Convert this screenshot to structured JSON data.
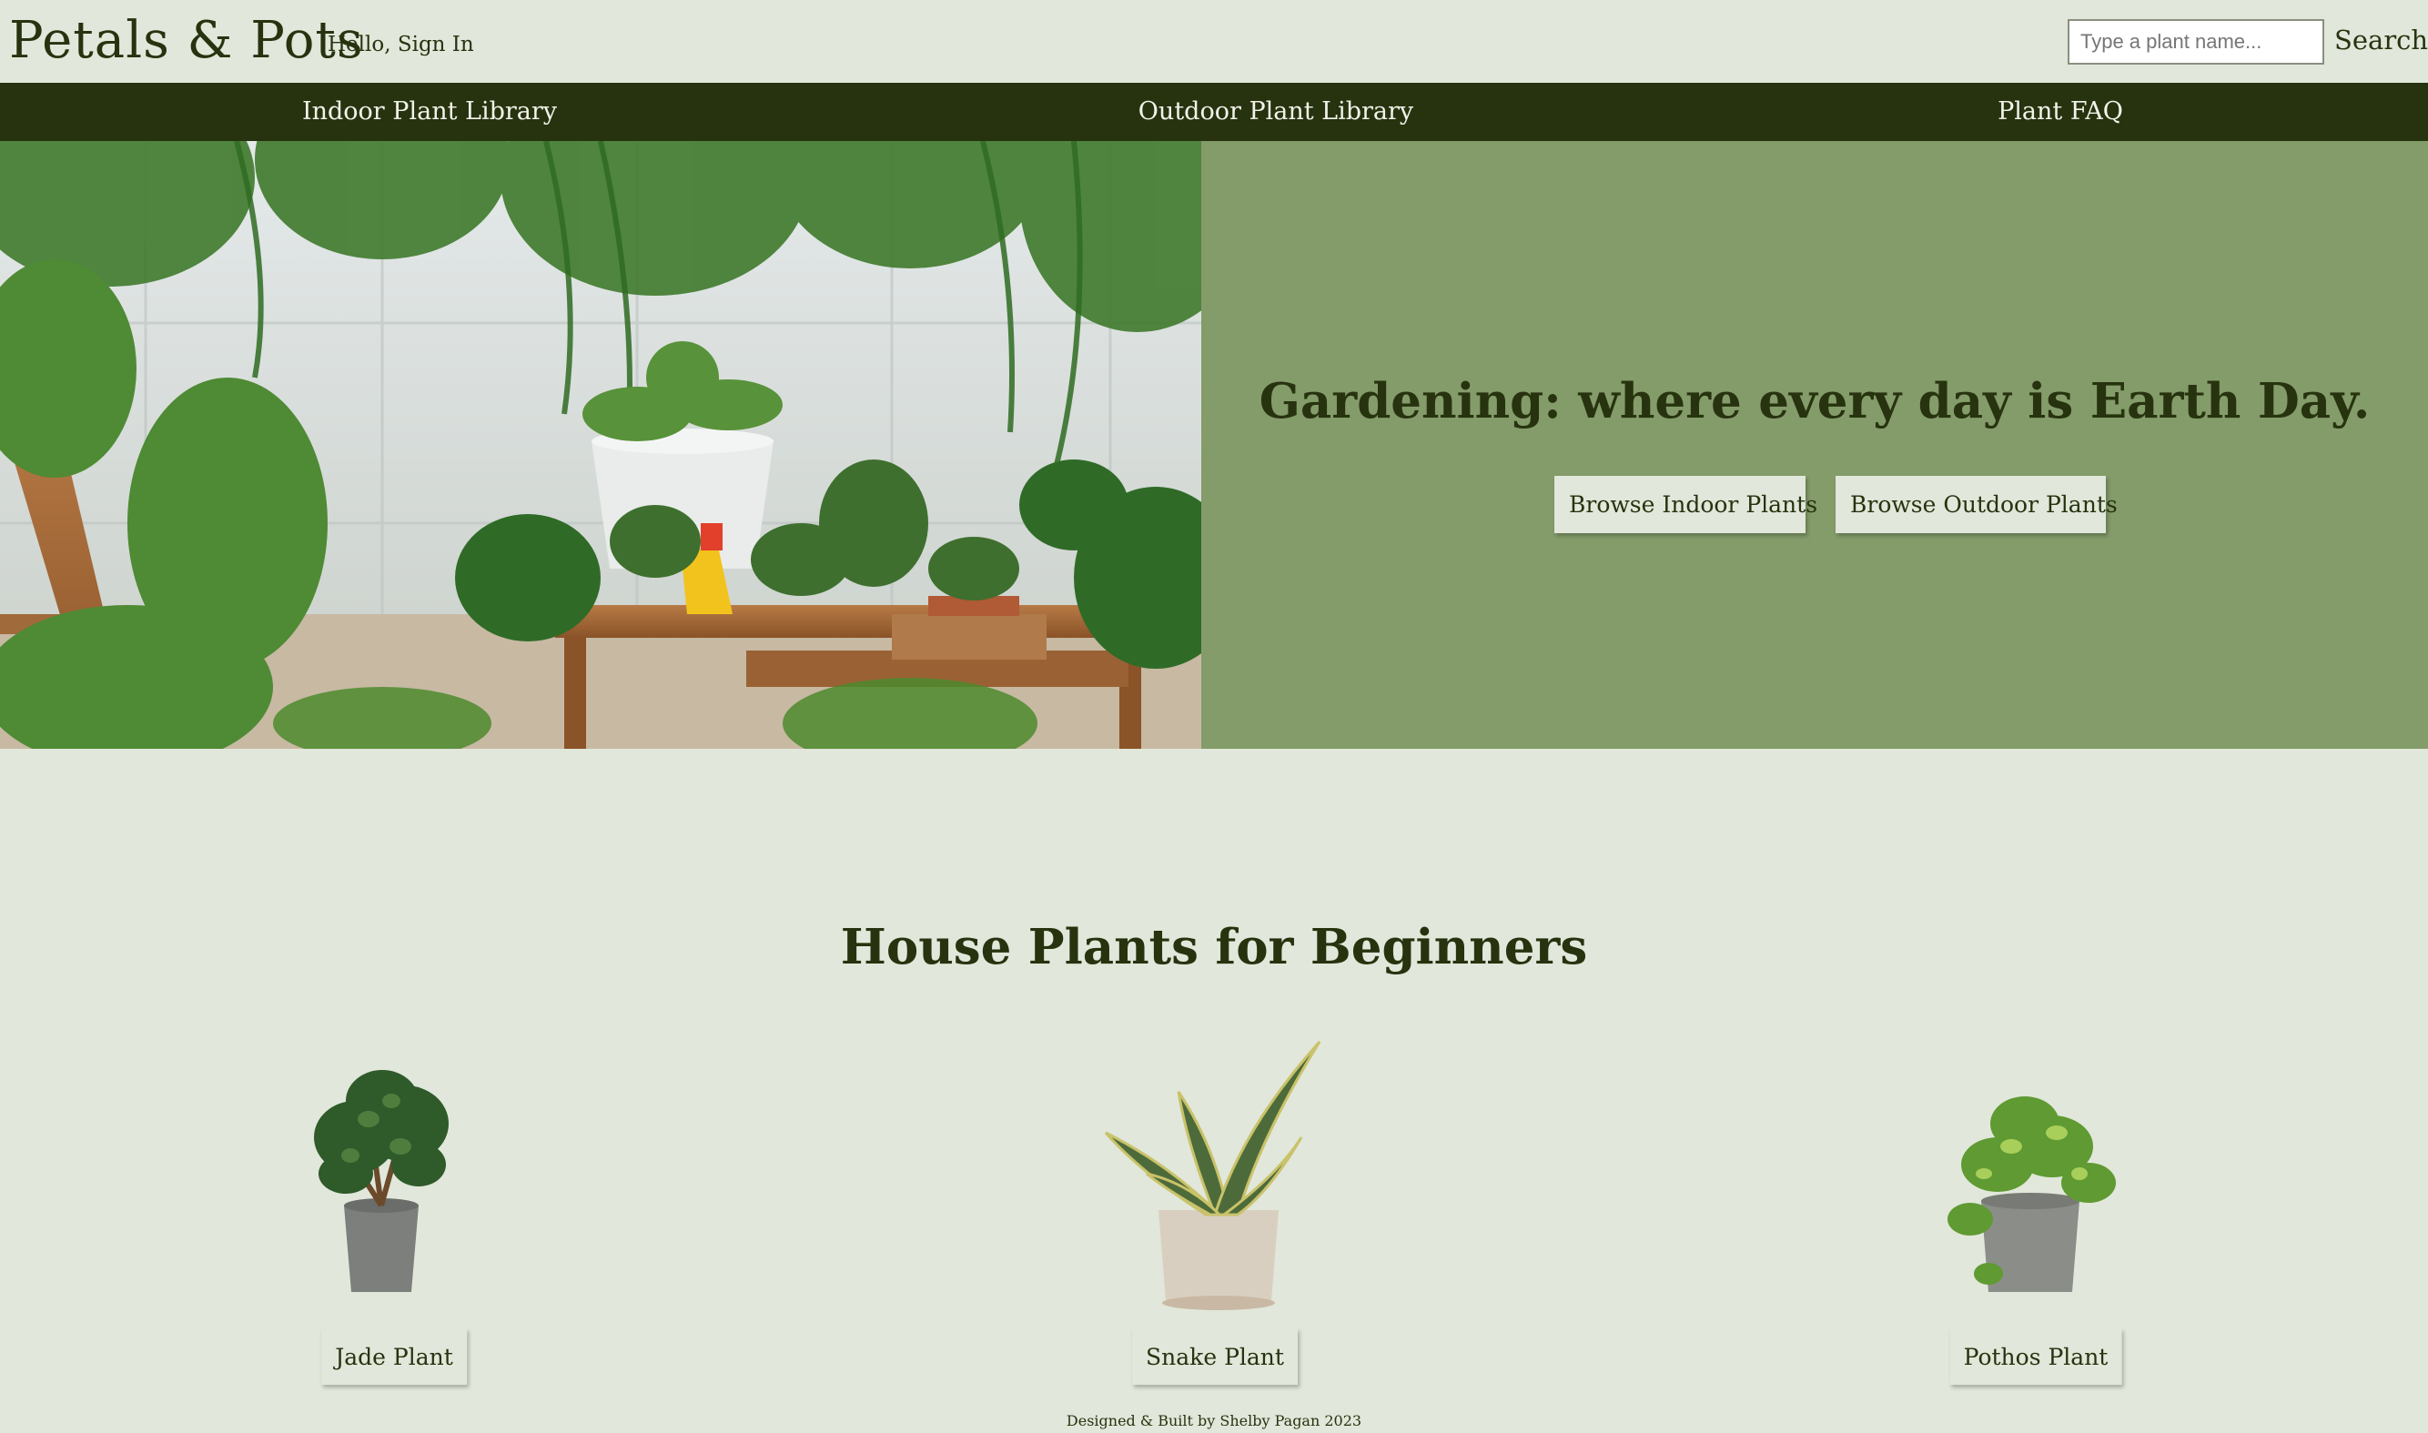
{
  "header": {
    "logo": "Petals & Pots",
    "greeting": "Hello, Sign In",
    "search": {
      "placeholder": "Type a plant name...",
      "value": "",
      "button_label": "Search"
    }
  },
  "nav": {
    "items": [
      {
        "label": "Indoor Plant Library"
      },
      {
        "label": "Outdoor Plant Library"
      },
      {
        "label": "Plant FAQ"
      }
    ]
  },
  "hero": {
    "title": "Gardening: where every day is Earth Day.",
    "buttons": [
      {
        "label": "Browse Indoor Plants"
      },
      {
        "label": "Browse Outdoor Plants"
      }
    ]
  },
  "beginners": {
    "title": "House Plants for Beginners",
    "plants": [
      {
        "name": "Jade Plant"
      },
      {
        "name": "Snake Plant"
      },
      {
        "name": "Pothos Plant"
      }
    ]
  },
  "footer": {
    "credit": "Designed & Built by Shelby Pagan 2023"
  },
  "colors": {
    "background": "#e1e7da",
    "nav": "#27330f",
    "hero_panel": "#849b6a",
    "text": "#27330f"
  }
}
